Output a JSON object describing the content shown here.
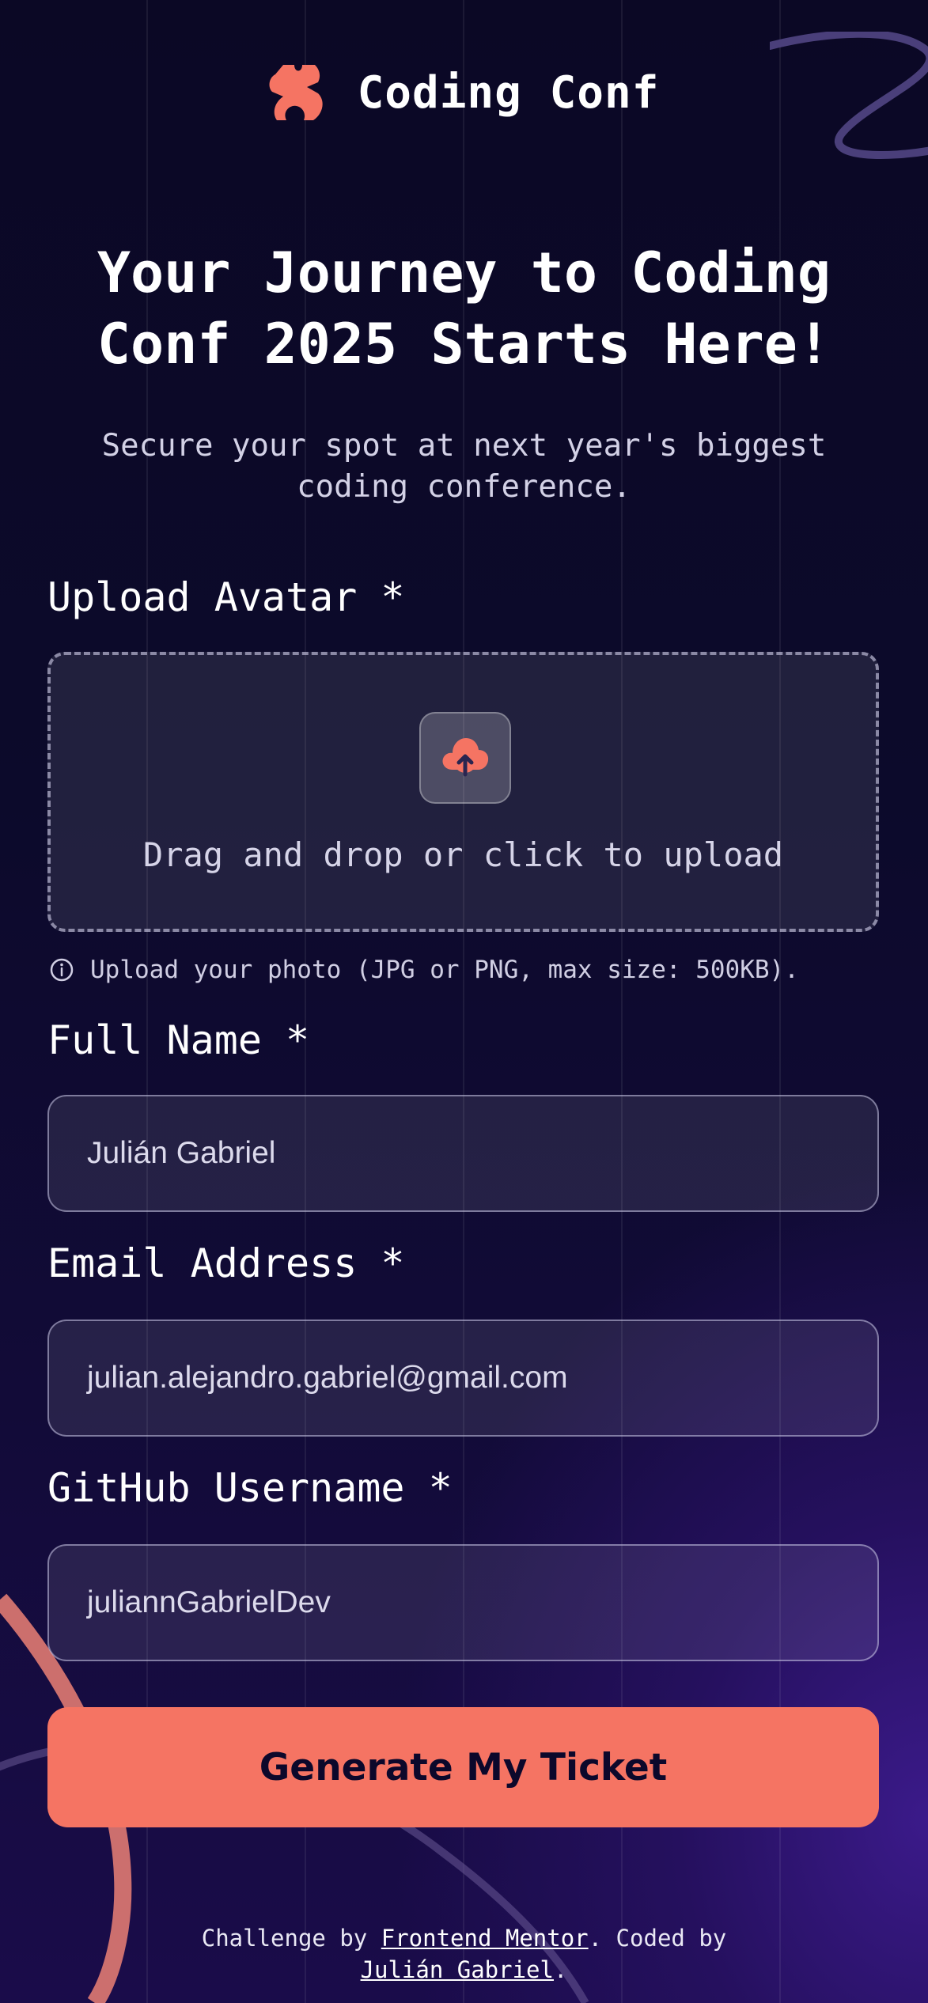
{
  "brand": {
    "name": "Coding Conf",
    "accent_color": "#f57463",
    "logo_icon": "coding-conf-logo-icon"
  },
  "hero": {
    "title": "Your Journey to Coding Conf 2025 Starts Here!",
    "subtitle": "Secure your spot at next year's biggest coding conference."
  },
  "form": {
    "avatar": {
      "label": "Upload Avatar *",
      "dropzone_text": "Drag and drop or click to upload",
      "hint": "Upload your photo (JPG or PNG, max size: 500KB).",
      "upload_icon": "cloud-upload-icon",
      "hint_icon": "info-icon"
    },
    "full_name": {
      "label": "Full Name *",
      "value": "Julián Gabriel"
    },
    "email": {
      "label": "Email Address *",
      "value": "julian.alejandro.gabriel@gmail.com"
    },
    "github": {
      "label": "GitHub Username *",
      "value": "juliannGabrielDev"
    },
    "submit_label": "Generate My Ticket"
  },
  "footer": {
    "prefix": "Challenge by ",
    "link1": "Frontend Mentor",
    "middle": ". Coded by ",
    "link2": "Julián Gabriel",
    "suffix": "."
  }
}
